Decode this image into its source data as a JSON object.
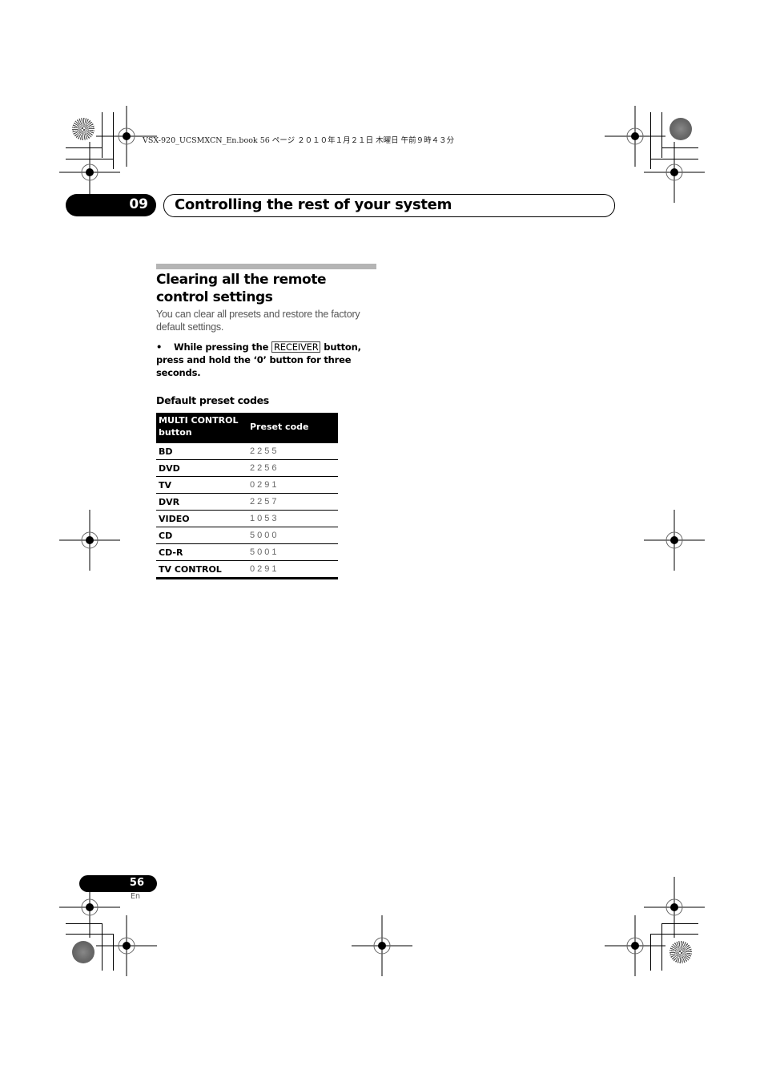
{
  "print_header": {
    "info": "VSX-920_UCSMXCN_En.book   56 ページ   ２０１０年１月２１日   木曜日   午前９時４３分"
  },
  "chapter": {
    "number": "09",
    "title": "Controlling the rest of your system"
  },
  "section": {
    "title": "Clearing all the remote control settings",
    "intro": "You can clear all presets and restore the factory default settings.",
    "step": {
      "bullet": "•",
      "before": "While pressing the",
      "key": "RECEIVER",
      "after": "button, press and hold the ‘0’ button for three seconds."
    }
  },
  "table": {
    "title": "Default preset codes",
    "headers": [
      "MULTI CONTROL button",
      "Preset code"
    ],
    "rows": [
      {
        "button": "BD",
        "code": "2255"
      },
      {
        "button": "DVD",
        "code": "2256"
      },
      {
        "button": "TV",
        "code": "0291"
      },
      {
        "button": "DVR",
        "code": "2257"
      },
      {
        "button": "VIDEO",
        "code": "1053"
      },
      {
        "button": "CD",
        "code": "5000"
      },
      {
        "button": "CD-R",
        "code": "5001"
      },
      {
        "button": "TV CONTROL",
        "code": "0291"
      }
    ]
  },
  "footer": {
    "page_number": "56",
    "language": "En"
  },
  "marks": {
    "registration_icon": "crosshair-target-icon",
    "disc_icon": "color-bar-disc-icon"
  }
}
